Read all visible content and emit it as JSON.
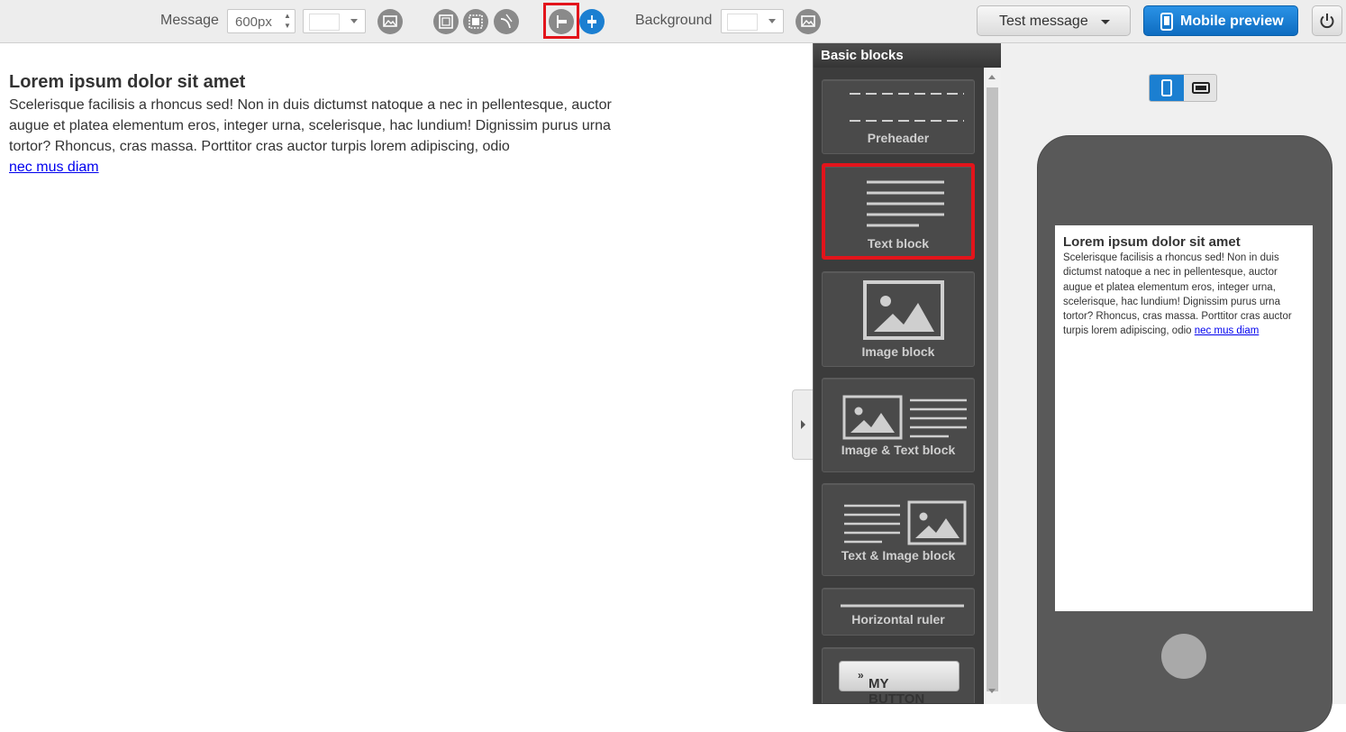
{
  "toolbar": {
    "message_label": "Message",
    "width_value": "600px",
    "background_label": "Background",
    "test_message_label": "Test message",
    "mobile_preview_label": "Mobile preview"
  },
  "canvas": {
    "title": "Lorem ipsum dolor sit amet",
    "body": "Scelerisque facilisis a rhoncus sed! Non in duis dictumst natoque a nec in pellentesque, auctor augue et platea elementum eros, integer urna, scelerisque, hac lundium! Dignissim purus urna tortor? Rhoncus, cras massa. Porttitor cras auctor turpis lorem adipiscing, odio",
    "link": "nec mus diam"
  },
  "panel": {
    "title": "Basic blocks",
    "blocks": [
      {
        "label": "Preheader",
        "icon": "preheader-icon"
      },
      {
        "label": "Text block",
        "icon": "text-lines-icon",
        "selected": true
      },
      {
        "label": "Image block",
        "icon": "image-icon"
      },
      {
        "label": "Image & Text block",
        "icon": "image-text-icon"
      },
      {
        "label": "Text & Image block",
        "icon": "text-image-icon"
      },
      {
        "label": "Horizontal ruler",
        "icon": "hr-icon"
      },
      {
        "label": "MY BUTTON",
        "icon": "button-icon"
      }
    ],
    "button_block_label": "MY BUTTON",
    "button_chevron": "»"
  },
  "preview": {
    "title": "Lorem ipsum dolor sit amet",
    "body": "Scelerisque facilisis a rhoncus sed! Non in duis dictumst natoque a nec in pellentesque, auctor augue et platea elementum eros, integer urna, scelerisque, hac lundium! Dignissim purus urna tortor? Rhoncus, cras massa. Porttitor cras auctor turpis lorem adipiscing, odio",
    "link": "nec mus diam"
  },
  "colors": {
    "accent_blue": "#1b7fd1",
    "highlight_red": "#e3141b",
    "panel_bg": "#3c3c3c",
    "phone_body": "#595959"
  }
}
